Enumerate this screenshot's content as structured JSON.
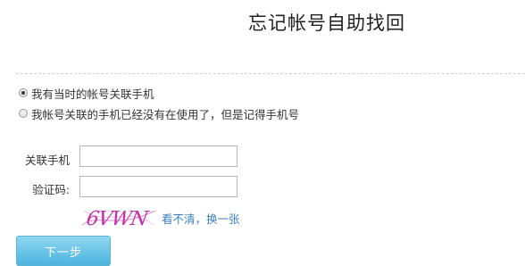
{
  "page": {
    "title": "忘记帐号自助找回"
  },
  "options": [
    {
      "label": "我有当时的帐号关联手机",
      "selected": true
    },
    {
      "label": "我帐号关联的手机已经没有在使用了，但是记得手机号",
      "selected": false
    }
  ],
  "form": {
    "phone_label": "关联手机",
    "phone_value": "",
    "code_label": "验证码:",
    "code_value": "",
    "captcha_text": "6VWN",
    "refresh_link": "看不清，换一张",
    "next_button": "下一步"
  },
  "colors": {
    "link": "#3a7fc1",
    "button_top": "#8fd7f0",
    "button_bottom": "#4cb3df",
    "captcha_text": "#c42fb0"
  }
}
